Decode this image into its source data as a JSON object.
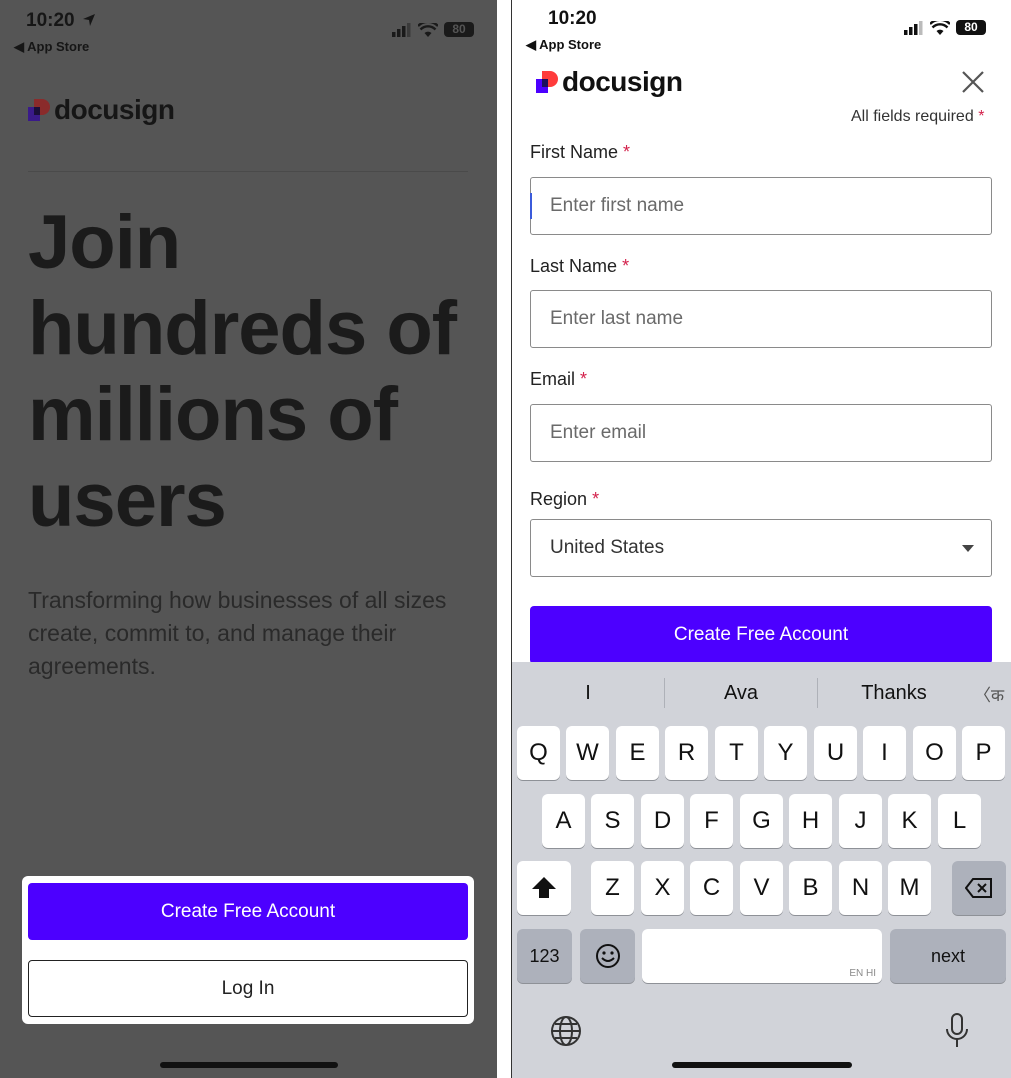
{
  "left": {
    "status": {
      "time": "10:20",
      "back": "◀ App Store",
      "battery": "80"
    },
    "logo": {
      "text": "docusign"
    },
    "headline": "Join hundreds of millions of users",
    "subtext": "Transforming how businesses of all sizes create, commit to, and manage their agreements.",
    "buttons": {
      "create": "Create Free Account",
      "login": "Log In"
    }
  },
  "right": {
    "status": {
      "time": "10:20",
      "back": "◀ App Store",
      "battery": "80"
    },
    "logo": {
      "text": "docusign"
    },
    "required_note": "All fields required",
    "star": "*",
    "fields": {
      "first_name": {
        "label": "First Name",
        "placeholder": "Enter first name"
      },
      "last_name": {
        "label": "Last Name",
        "placeholder": "Enter last name"
      },
      "email": {
        "label": "Email",
        "placeholder": "Enter email"
      },
      "region": {
        "label": "Region",
        "value": "United States"
      }
    },
    "create_button": "Create Free Account",
    "keyboard": {
      "suggestions": [
        "I",
        "Ava",
        "Thanks",
        "〈क"
      ],
      "row1": [
        "Q",
        "W",
        "E",
        "R",
        "T",
        "Y",
        "U",
        "I",
        "O",
        "P"
      ],
      "row2": [
        "A",
        "S",
        "D",
        "F",
        "G",
        "H",
        "J",
        "K",
        "L"
      ],
      "row3": [
        "Z",
        "X",
        "C",
        "V",
        "B",
        "N",
        "M"
      ],
      "numbers_key": "123",
      "space_hint": "EN HI",
      "next_key": "next"
    }
  },
  "colors": {
    "brand": "#4c00ff",
    "required": "#d3214b",
    "logo_red": "#ff3c3c",
    "logo_purple": "#4c00ff"
  }
}
